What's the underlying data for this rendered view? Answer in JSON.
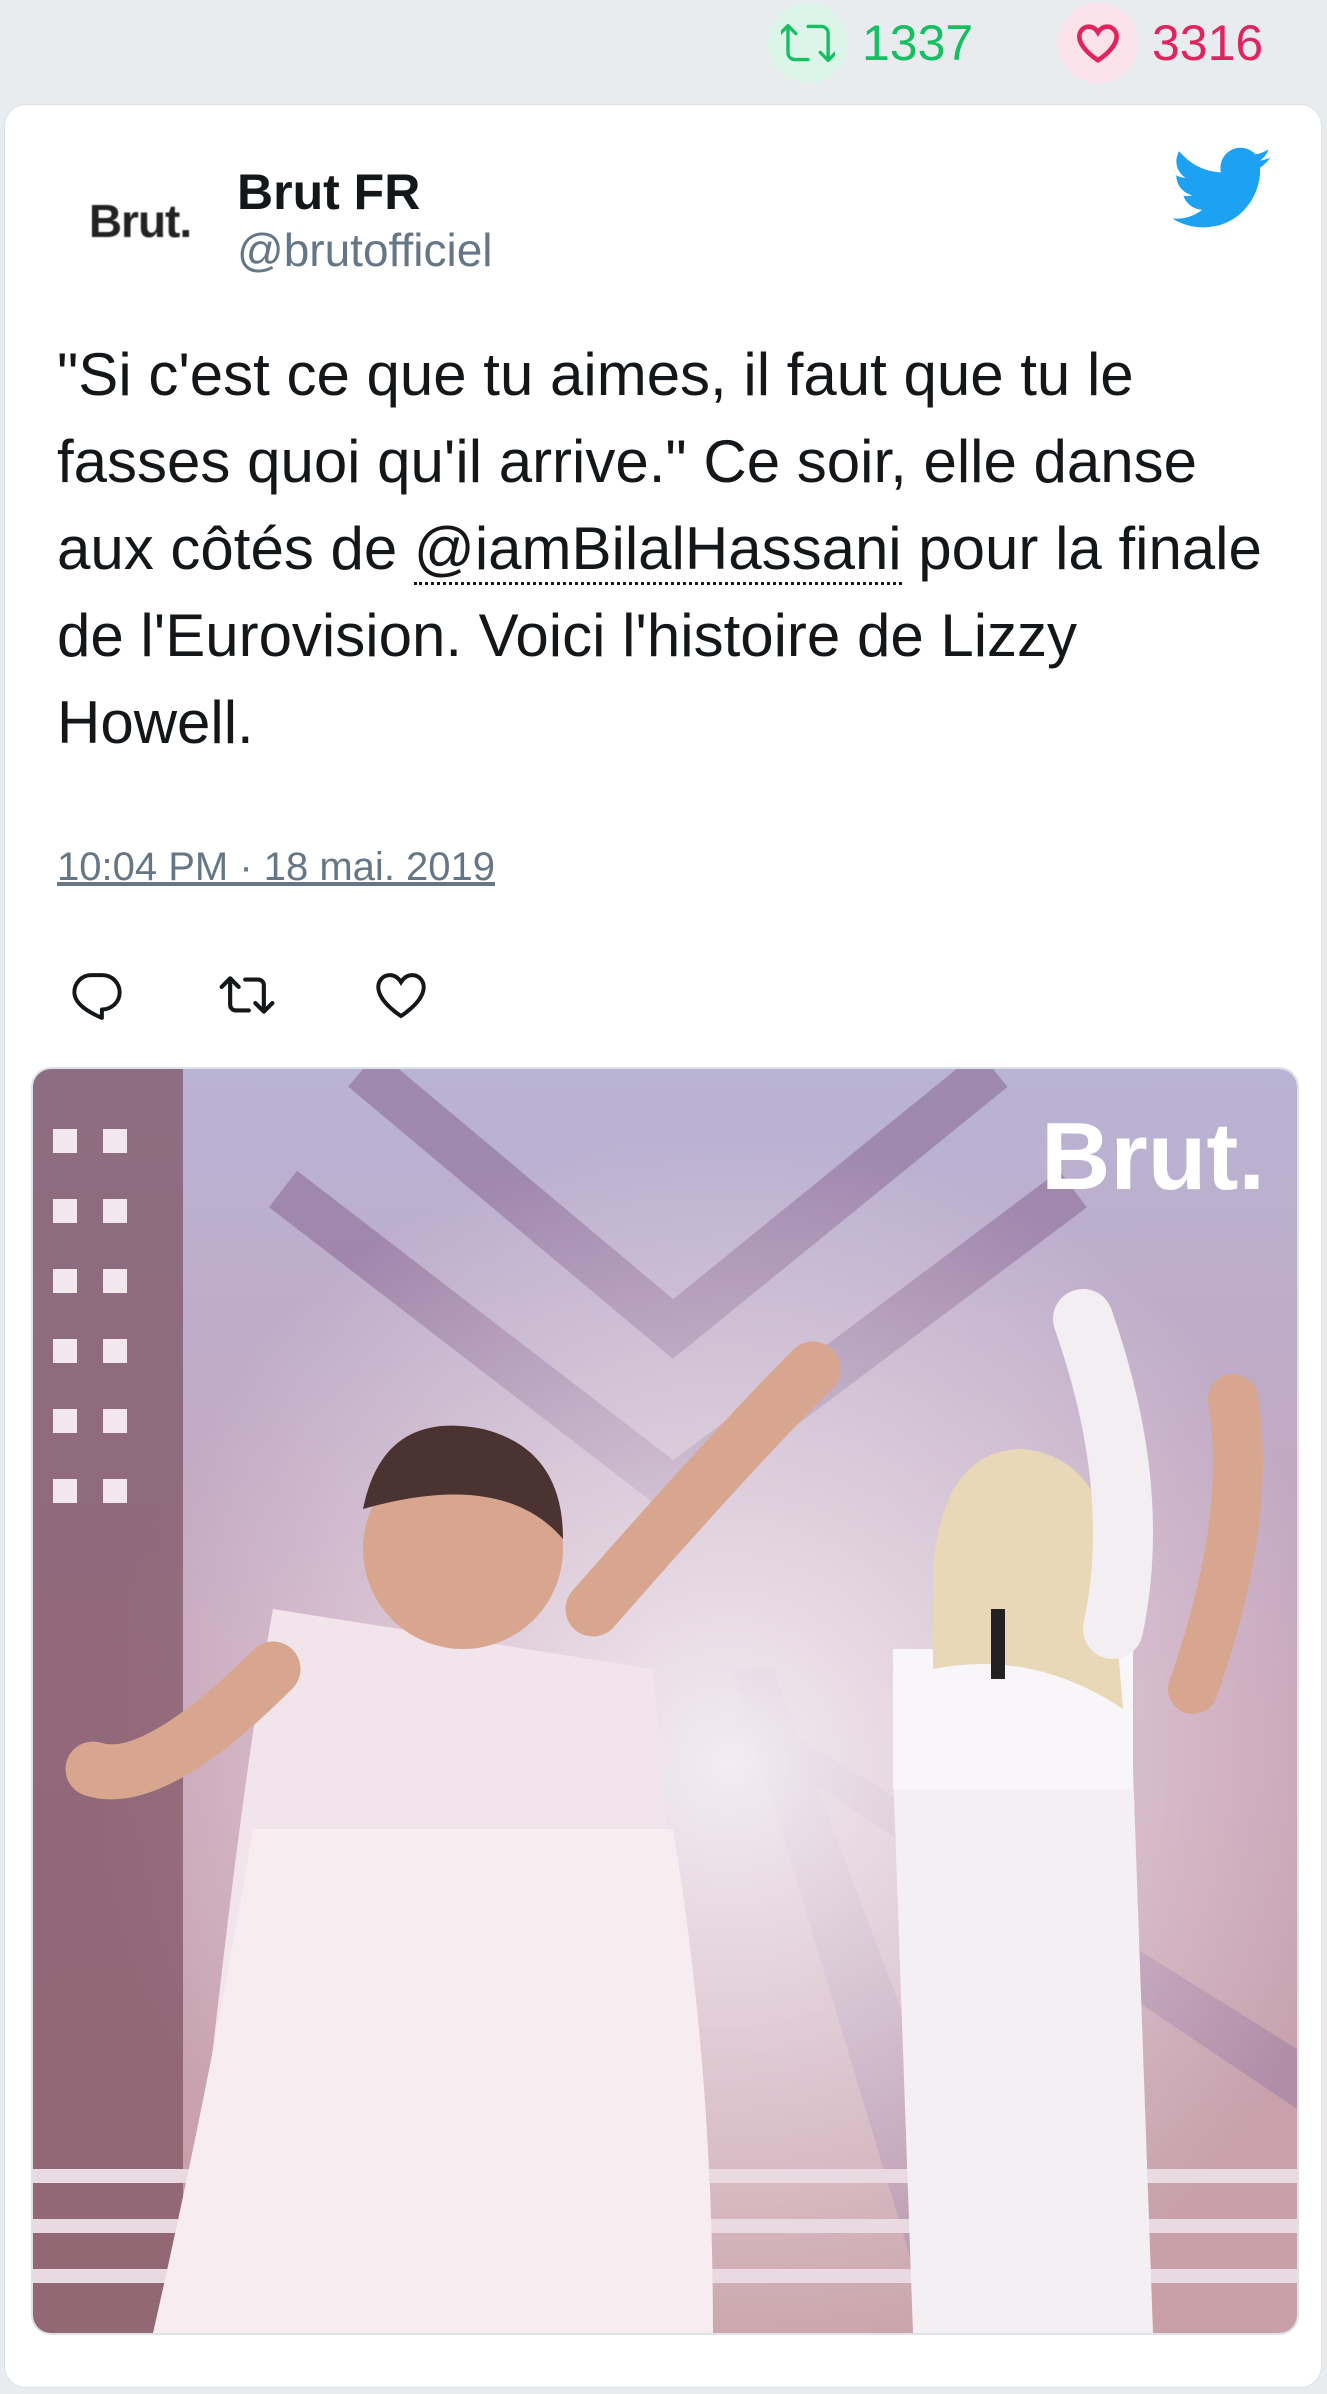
{
  "stats": {
    "retweet_count": "1337",
    "like_count": "3316",
    "retweet_icon": "retweet-icon",
    "like_icon": "heart-icon",
    "retweet_color": "#17bf63",
    "like_color": "#e0245e"
  },
  "tweet": {
    "avatar_text": "Brut.",
    "display_name": "Brut FR",
    "handle": "@brutofficiel",
    "text_before": "\"Si c'est ce que tu aimes, il faut que tu le fasses quoi qu'il arrive.\" Ce soir, elle danse aux côtés de ",
    "mention": "@iamBilalHassani",
    "text_after": " pour la finale de l'Eurovision. Voici l'histoire de Lizzy Howell.",
    "timestamp": "10:04 PM · 18 mai. 2019",
    "brand_color": "#1da1f2"
  },
  "actions": {
    "reply_icon": "reply-icon",
    "retweet_icon": "retweet-icon",
    "like_icon": "heart-icon"
  },
  "media": {
    "watermark": "Brut."
  }
}
